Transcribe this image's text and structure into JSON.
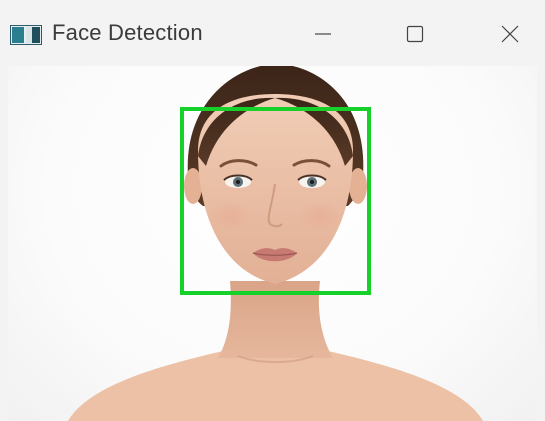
{
  "window": {
    "title": "Face Detection",
    "controls": {
      "minimize": "—",
      "maximize": "☐",
      "close": "✕"
    }
  },
  "icons": {
    "app": "app-window-icon",
    "minimize": "minimize-icon",
    "maximize": "maximize-icon",
    "close": "close-icon"
  },
  "detection": {
    "box_color": "#16d12a"
  },
  "colors": {
    "titlebar": "#f3f3f3",
    "title_text": "#3b3b3b",
    "background": "#ffffff"
  }
}
